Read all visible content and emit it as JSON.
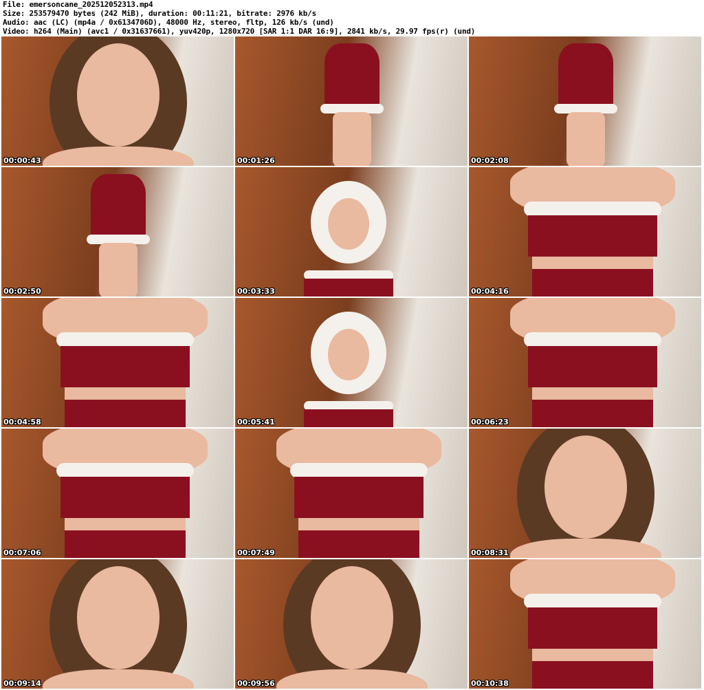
{
  "header": {
    "file": "File: emersoncane_202512052313.mp4",
    "size": "Size: 253579470 bytes (242 MiB), duration: 00:11:21, bitrate: 2976 kb/s",
    "audio": "Audio: aac (LC) (mp4a / 0x6134706D), 48000 Hz, stereo, fltp, 126 kb/s (und)",
    "video": "Video: h264 (Main) (avc1 / 0x31637661), yuv420p, 1280x720 [SAR 1:1 DAR 16:9], 2841 kb/s, 29.97 fps(r) (und)"
  },
  "thumbnails": [
    {
      "timestamp": "00:00:43",
      "scene": "face"
    },
    {
      "timestamp": "00:01:26",
      "scene": "dress-full"
    },
    {
      "timestamp": "00:02:08",
      "scene": "dress-full"
    },
    {
      "timestamp": "00:02:50",
      "scene": "dress-full"
    },
    {
      "timestamp": "00:03:33",
      "scene": "wig"
    },
    {
      "timestamp": "00:04:16",
      "scene": "torso"
    },
    {
      "timestamp": "00:04:58",
      "scene": "torso"
    },
    {
      "timestamp": "00:05:41",
      "scene": "wig"
    },
    {
      "timestamp": "00:06:23",
      "scene": "torso"
    },
    {
      "timestamp": "00:07:06",
      "scene": "torso"
    },
    {
      "timestamp": "00:07:49",
      "scene": "torso"
    },
    {
      "timestamp": "00:08:31",
      "scene": "face"
    },
    {
      "timestamp": "00:09:14",
      "scene": "face"
    },
    {
      "timestamp": "00:09:56",
      "scene": "face"
    },
    {
      "timestamp": "00:10:38",
      "scene": "torso"
    }
  ],
  "colors": {
    "wood": "#a8582c",
    "wall": "#e9e4dc",
    "velvet": "#8a1020",
    "fur": "#f4f1ec",
    "skin": "#e9b9a0",
    "hair": "#5b3a24"
  }
}
